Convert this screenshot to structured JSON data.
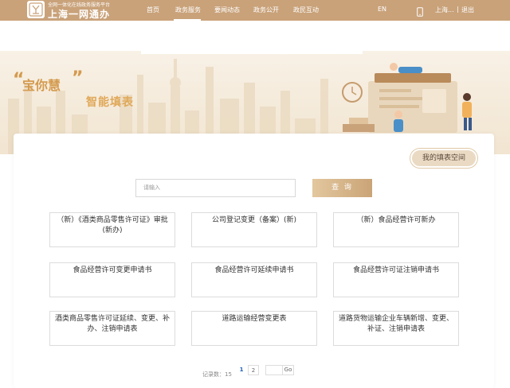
{
  "header": {
    "logo_tagline": "全网一体化在线政务服务平台",
    "logo_title": "上海一网通办",
    "nav": [
      "首页",
      "政务服务",
      "要闻动态",
      "政务公开",
      "政民互动"
    ],
    "active_nav": "政务服务",
    "lang": "EN",
    "user": "上海...",
    "separator": "|",
    "logout": "退出"
  },
  "banner": {
    "quote_open": "“",
    "slogan_main": "宝你慧",
    "quote_close": "”",
    "slogan_sub": "智能填表"
  },
  "main": {
    "my_space_label": "我的填表空间",
    "search_placeholder": "请输入",
    "search_button": "查 询",
    "forms": [
      "（新）《酒类商品零售许可证》审批(新办)",
      "公司登记变更（备案）(新)",
      "（新）食品经营许可新办",
      "食品经营许可变更申请书",
      "食品经营许可延续申请书",
      "食品经营许可证注销申请书",
      "酒类商品零售许可证延续、变更、补办、注销申请表",
      "道路运输经营变更表",
      "道路货物运输企业车辆新增、变更、补证、注销申请表"
    ],
    "pager": {
      "total_label": "记录数：15",
      "pages": [
        "1",
        "2"
      ],
      "go_label": "Go"
    }
  },
  "colors": {
    "header_bg": "#c9a27a",
    "accent_gold": "#d49a4e",
    "active_page": "#1f5fb8"
  }
}
